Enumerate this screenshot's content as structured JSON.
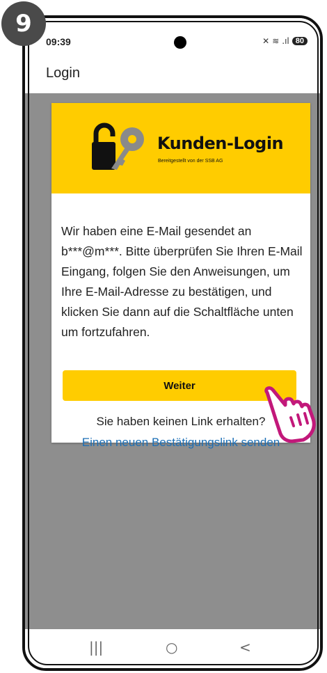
{
  "step_number": "9",
  "status_bar": {
    "time": "09:39",
    "battery": "80"
  },
  "app_bar": {
    "title": "Login"
  },
  "card": {
    "header_title": "Kunden-Login",
    "header_subtitle": "Bereitgestellt von der SSB AG",
    "message": "Wir haben eine E-Mail gesendet an b***@m***. Bitte überprüfen Sie Ihren E-Mail Eingang, folgen Sie den Anweisungen, um Ihre E-Mail-Adresse zu bestätigen, und klicken Sie dann auf die Schaltfläche unten um fortzufahren.",
    "continue_button": "Weiter",
    "no_link_text": "Sie haben keinen Link erhalten?",
    "resend_link": "Einen neuen Bestätigungslink senden"
  },
  "nav_bar": {
    "recents_icon": "|||",
    "home_icon": "○",
    "back_icon": "<"
  },
  "colors": {
    "accent_yellow": "#ffcc00",
    "link_blue": "#1c6fb6",
    "overlay_gray": "#8e8e8e",
    "hand_magenta": "#c2187a"
  },
  "icons": [
    "key-lock-logo-icon",
    "pointing-hand-icon"
  ]
}
